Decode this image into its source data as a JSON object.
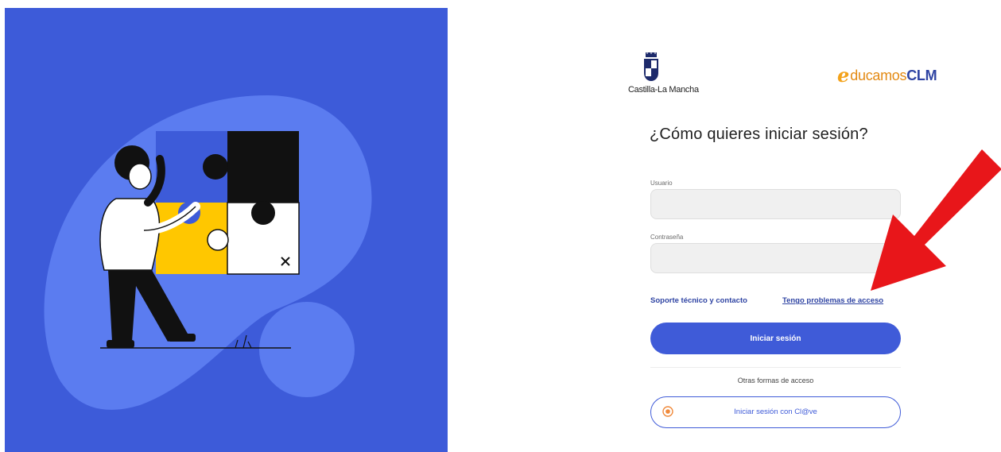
{
  "hero": {
    "illustration": "person-assembling-puzzle",
    "colors": {
      "background": "#3d5bd9",
      "blob": "#5b7cf0",
      "accent": "#ffc700"
    }
  },
  "logos": {
    "jccm_text": "Castilla-La Mancha",
    "educamos_e": "e",
    "educamos_word": "ducamos",
    "educamos_clm": "CLM"
  },
  "login": {
    "title": "¿Cómo quieres iniciar sesión?",
    "username_label": "Usuario",
    "username_value": "",
    "password_label": "Contraseña",
    "password_value": "",
    "support_link": "Soporte técnico y contacto",
    "access_problems_link": "Tengo problemas de acceso",
    "submit_label": "Iniciar sesión",
    "other_methods": "Otras formas de acceso",
    "clave_button_label": "Iniciar sesión con Cl@ve"
  },
  "colors": {
    "primary": "#3f5bd8",
    "link": "#2f44a3",
    "arrow": "#e8161a",
    "clave_icon": "#f08a3c"
  }
}
